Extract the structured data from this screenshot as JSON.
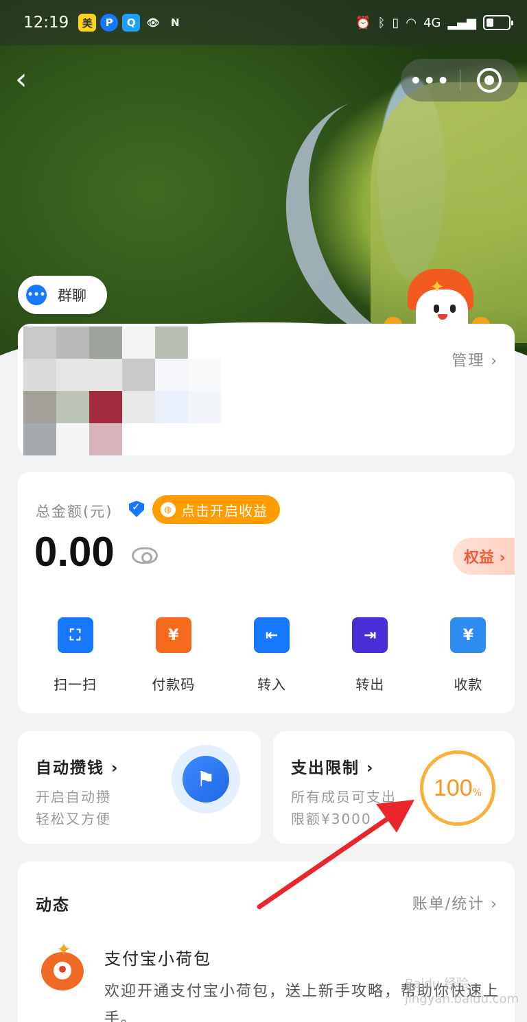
{
  "status_bar": {
    "time": "12:19",
    "app_badges": [
      "美",
      "P",
      "Q",
      "👁",
      "N"
    ],
    "network": "4G"
  },
  "nav": {
    "back_icon": "chevron-left-icon",
    "more_icon": "more-dots-icon",
    "close_icon": "target-circle-icon"
  },
  "group_chat": {
    "label": "群聊"
  },
  "members": {
    "manage_label": "管理 ›"
  },
  "balance": {
    "label": "总金额(元)",
    "earn_button": "点击开启收益",
    "amount": "0.00",
    "rights_label": "权益 ›"
  },
  "actions": [
    {
      "label": "扫一扫",
      "icon": "scan-icon",
      "glyph": "⛶",
      "color": "#1677ff"
    },
    {
      "label": "付款码",
      "icon": "payment-code-icon",
      "glyph": "¥",
      "color": "#f56a1c"
    },
    {
      "label": "转入",
      "icon": "transfer-in-icon",
      "glyph": "⇤",
      "color": "#1677ff"
    },
    {
      "label": "转出",
      "icon": "transfer-out-icon",
      "glyph": "⇥",
      "color": "#4a2fd6"
    },
    {
      "label": "收款",
      "icon": "receive-money-icon",
      "glyph": "¥",
      "color": "#2d8cf0"
    }
  ],
  "auto_save": {
    "title": "自动攒钱 ›",
    "line1": "开启自动攒",
    "line2": "轻松又方便"
  },
  "spend_limit": {
    "title": "支出限制 ›",
    "line1": "所有成员可支出",
    "line2": "限额¥3000",
    "percent": "100",
    "percent_sign": "%"
  },
  "activity": {
    "title": "动态",
    "link": "账单/统计 ›",
    "message_title": "支付宝小荷包",
    "message_body": "欢迎开通支付宝小荷包，送上新手攻略，帮助你快速上手。"
  },
  "watermark": "Baidu 经验 jingyan.baidu.com",
  "colors": {
    "accent": "#1677ff",
    "orange": "#ff9d00",
    "annotation_arrow": "#e8262b"
  }
}
